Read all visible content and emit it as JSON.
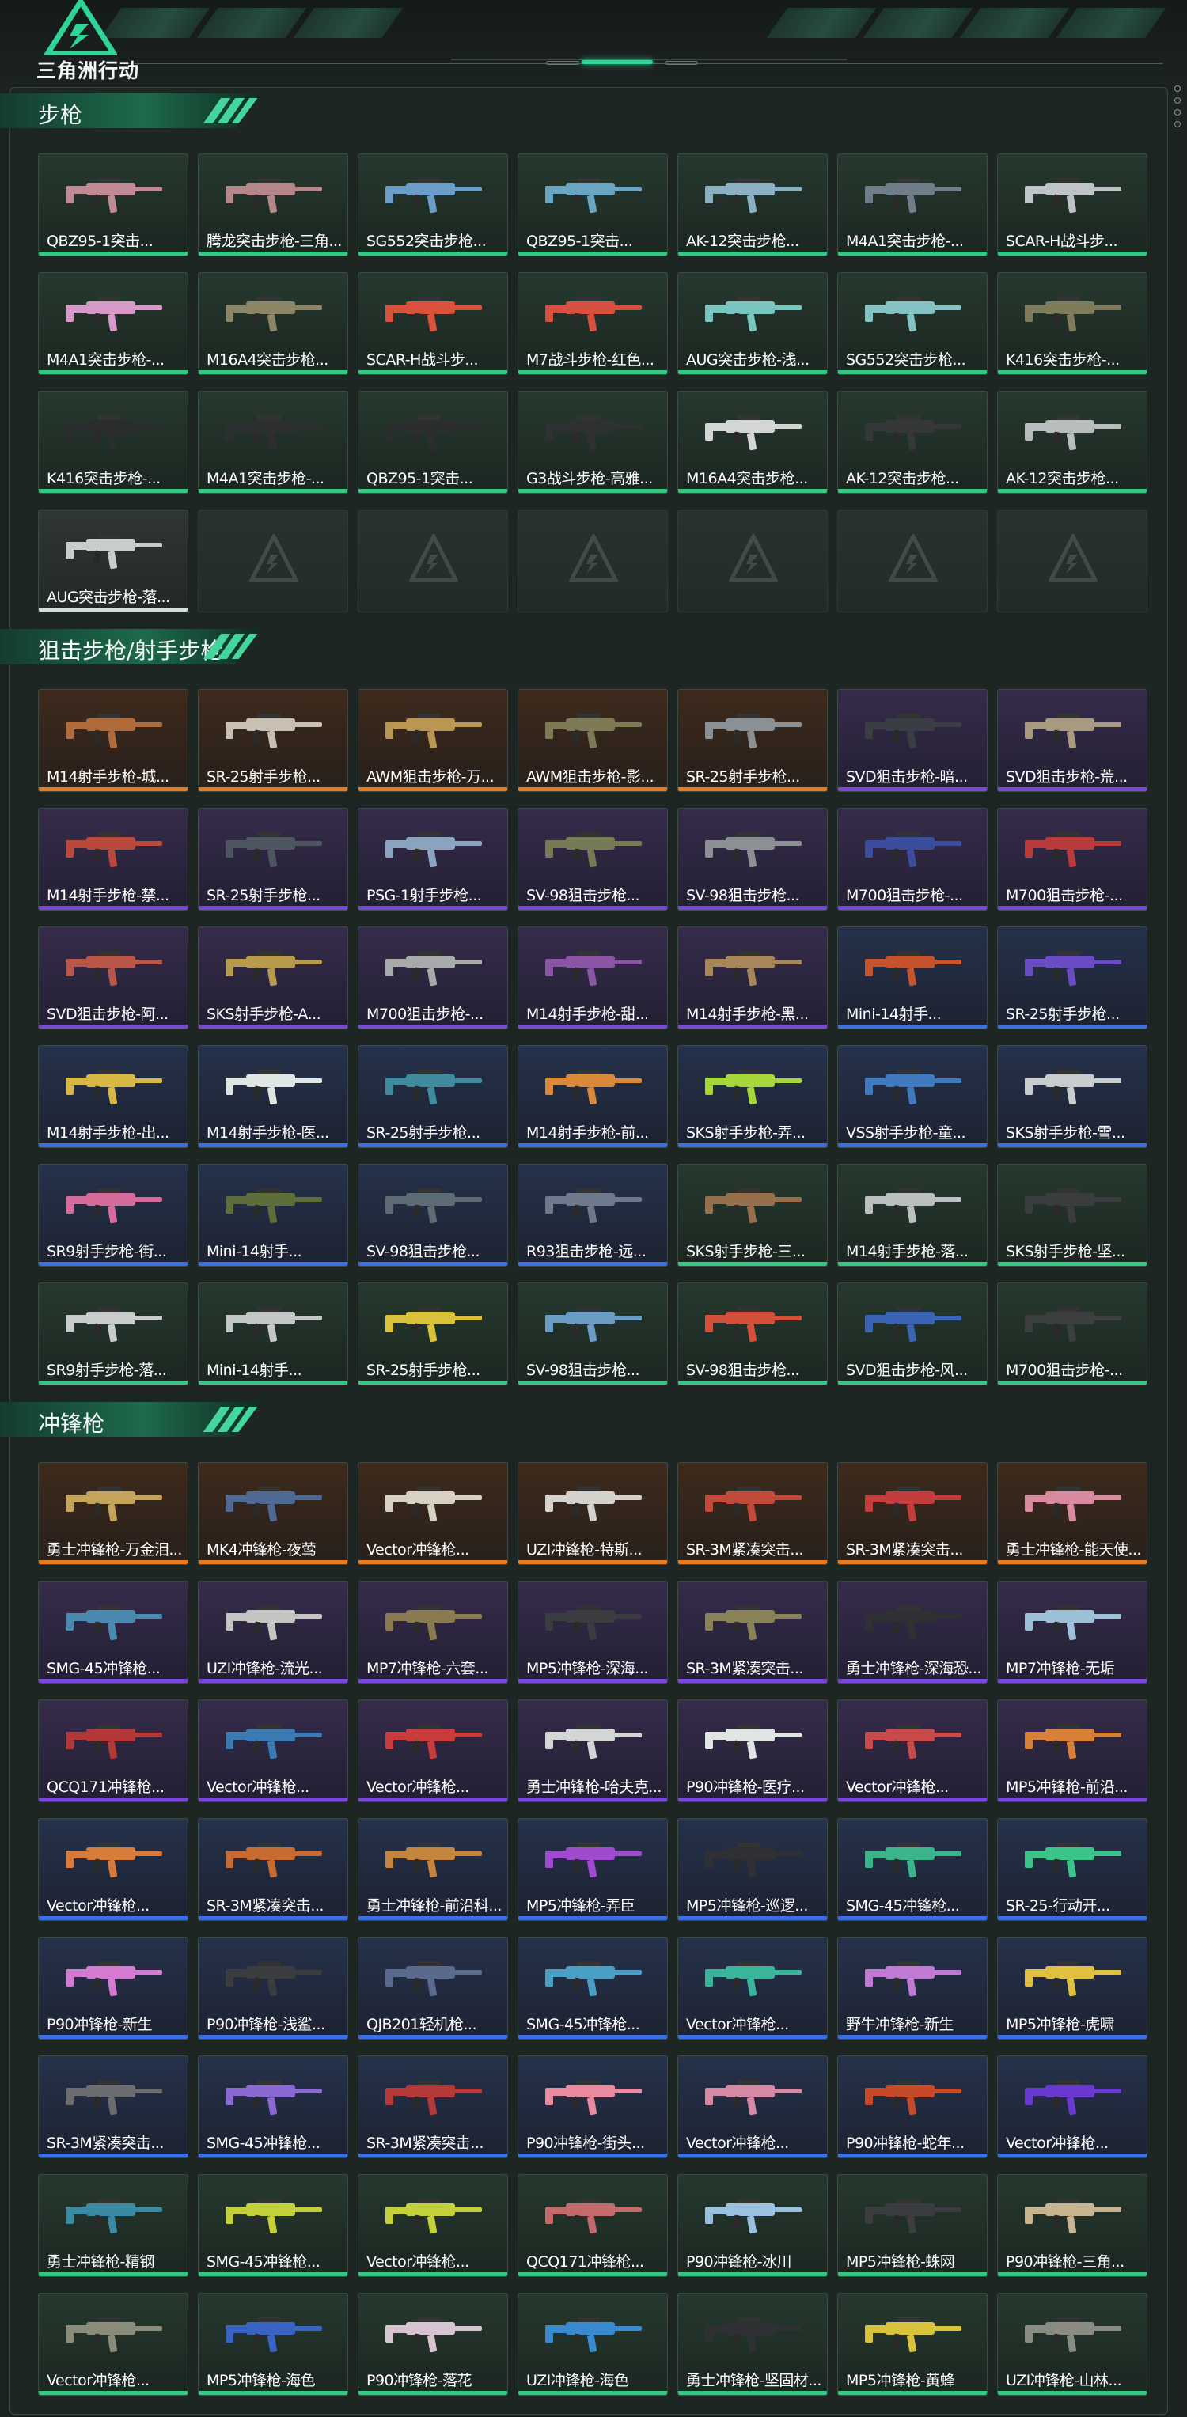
{
  "header": {
    "logo_text": "三角洲行动"
  },
  "sections": [
    {
      "title": "步枪",
      "rarity_colors": {
        "white": "#d6dcda",
        "green": "#37c783",
        "blue": "#3c6fe0",
        "purple": "#7a48d6",
        "orange": "#e57b23"
      },
      "items": [
        {
          "label": "QBZ95-1突击...",
          "rarity": "green",
          "tint": "#c08a94"
        },
        {
          "label": "腾龙突击步枪-三角...",
          "rarity": "green",
          "tint": "#b4878b"
        },
        {
          "label": "SG552突击步枪...",
          "rarity": "green",
          "tint": "#6a9ec8"
        },
        {
          "label": "QBZ95-1突击...",
          "rarity": "green",
          "tint": "#6aa5c2"
        },
        {
          "label": "AK-12突击步枪...",
          "rarity": "green",
          "tint": "#8bb0c4"
        },
        {
          "label": "M4A1突击步枪-...",
          "rarity": "green",
          "tint": "#6f7e88"
        },
        {
          "label": "SCAR-H战斗步...",
          "rarity": "green",
          "tint": "#bfc4c6"
        },
        {
          "label": "M4A1突击步枪-...",
          "rarity": "green",
          "tint": "#d79ac8"
        },
        {
          "label": "M16A4突击步枪...",
          "rarity": "green",
          "tint": "#8c8666"
        },
        {
          "label": "SCAR-H战斗步...",
          "rarity": "green",
          "tint": "#d9523b"
        },
        {
          "label": "M7战斗步枪-红色...",
          "rarity": "green",
          "tint": "#d8503f"
        },
        {
          "label": "AUG突击步枪-浅...",
          "rarity": "green",
          "tint": "#79c5c0"
        },
        {
          "label": "SG552突击步枪...",
          "rarity": "green",
          "tint": "#84c2c4"
        },
        {
          "label": "K416突击步枪-...",
          "rarity": "green",
          "tint": "#7f7c5c"
        },
        {
          "label": "K416突击步枪-...",
          "rarity": "green",
          "tint": "#2a2c2d"
        },
        {
          "label": "M4A1突击步枪-...",
          "rarity": "green",
          "tint": "#2c2e30"
        },
        {
          "label": "QBZ95-1突击...",
          "rarity": "green",
          "tint": "#2b2d2e"
        },
        {
          "label": "G3战斗步枪-高雅...",
          "rarity": "green",
          "tint": "#2e3032"
        },
        {
          "label": "M16A4突击步枪...",
          "rarity": "green",
          "tint": "#d4d6d6"
        },
        {
          "label": "AK-12突击步枪...",
          "rarity": "green",
          "tint": "#353739"
        },
        {
          "label": "AK-12突击步枪...",
          "rarity": "green",
          "tint": "#b8bcbc"
        },
        {
          "label": "AUG突击步枪-落...",
          "rarity": "white",
          "tint": "#c9cccc"
        },
        {
          "empty": true
        },
        {
          "empty": true
        },
        {
          "empty": true
        },
        {
          "empty": true
        },
        {
          "empty": true
        },
        {
          "empty": true
        }
      ]
    },
    {
      "title": "狙击步枪/射手步枪",
      "items": [
        {
          "label": "M14射手步枪-城...",
          "rarity": "orange",
          "tint": "#b06b3a"
        },
        {
          "label": "SR-25射手步枪...",
          "rarity": "orange",
          "tint": "#c9c0b4"
        },
        {
          "label": "AWM狙击步枪-万...",
          "rarity": "orange",
          "tint": "#b99652"
        },
        {
          "label": "AWM狙击步枪-影...",
          "rarity": "orange",
          "tint": "#7d7a55"
        },
        {
          "label": "SR-25射手步枪...",
          "rarity": "orange",
          "tint": "#8a9094"
        },
        {
          "label": "SVD狙击步枪-暗...",
          "rarity": "purple",
          "tint": "#3b3d44"
        },
        {
          "label": "SVD狙击步枪-荒...",
          "rarity": "purple",
          "tint": "#a89a80"
        },
        {
          "label": "M14射手步枪-禁...",
          "rarity": "purple",
          "tint": "#b9493a"
        },
        {
          "label": "SR-25射手步枪...",
          "rarity": "purple",
          "tint": "#4d5560"
        },
        {
          "label": "PSG-1射手步枪...",
          "rarity": "purple",
          "tint": "#8aa4c0"
        },
        {
          "label": "SV-98狙击步枪...",
          "rarity": "purple",
          "tint": "#767a55"
        },
        {
          "label": "SV-98狙击步枪...",
          "rarity": "purple",
          "tint": "#8c8f94"
        },
        {
          "label": "M700狙击步枪-...",
          "rarity": "purple",
          "tint": "#3a4c9c"
        },
        {
          "label": "M700狙击步枪-...",
          "rarity": "purple",
          "tint": "#b83a3a"
        },
        {
          "label": "SVD狙击步枪-阿...",
          "rarity": "purple",
          "tint": "#b9564a"
        },
        {
          "label": "SKS射手步枪-A...",
          "rarity": "purple",
          "tint": "#b79a4c"
        },
        {
          "label": "M700狙击步枪-...",
          "rarity": "purple",
          "tint": "#a8a9ab"
        },
        {
          "label": "M14射手步枪-甜...",
          "rarity": "purple",
          "tint": "#8a55a4"
        },
        {
          "label": "M14射手步枪-黑...",
          "rarity": "purple",
          "tint": "#a8865c"
        },
        {
          "label": "Mini-14射手...",
          "rarity": "blue",
          "tint": "#c4532e"
        },
        {
          "label": "SR-25射手步枪...",
          "rarity": "blue",
          "tint": "#6a4cc4"
        },
        {
          "label": "M14射手步枪-出...",
          "rarity": "blue",
          "tint": "#d8b844"
        },
        {
          "label": "M14射手步枪-医...",
          "rarity": "blue",
          "tint": "#dfe6e4"
        },
        {
          "label": "SR-25射手步枪...",
          "rarity": "blue",
          "tint": "#3f8a9c"
        },
        {
          "label": "M14射手步枪-前...",
          "rarity": "blue",
          "tint": "#d88a3a"
        },
        {
          "label": "SKS射手步枪-弄...",
          "rarity": "blue",
          "tint": "#a7d63a"
        },
        {
          "label": "VSS射手步枪-童...",
          "rarity": "blue",
          "tint": "#3f7ac0"
        },
        {
          "label": "SKS射手步枪-雪...",
          "rarity": "blue",
          "tint": "#c9cccc"
        },
        {
          "label": "SR9射手步枪-街...",
          "rarity": "blue",
          "tint": "#d46b9a"
        },
        {
          "label": "Mini-14射手...",
          "rarity": "blue",
          "tint": "#5e6e3a"
        },
        {
          "label": "SV-98狙击步枪...",
          "rarity": "blue",
          "tint": "#5d6c74"
        },
        {
          "label": "R93狙击步枪-远...",
          "rarity": "blue",
          "tint": "#6e7a8c"
        },
        {
          "label": "SKS射手步枪-三...",
          "rarity": "green",
          "tint": "#96704c"
        },
        {
          "label": "M14射手步枪-落...",
          "rarity": "green",
          "tint": "#bcbfc0"
        },
        {
          "label": "SKS射手步枪-坚...",
          "rarity": "green",
          "tint": "#3a3c3e"
        },
        {
          "label": "SR9射手步枪-落...",
          "rarity": "green",
          "tint": "#c9cccc"
        },
        {
          "label": "Mini-14射手...",
          "rarity": "green",
          "tint": "#c4c7c8"
        },
        {
          "label": "SR-25射手步枪...",
          "rarity": "green",
          "tint": "#d9c23a"
        },
        {
          "label": "SV-98狙击步枪...",
          "rarity": "green",
          "tint": "#6a9cc4"
        },
        {
          "label": "SV-98狙击步枪...",
          "rarity": "green",
          "tint": "#d4503a"
        },
        {
          "label": "SVD狙击步枪-风...",
          "rarity": "green",
          "tint": "#3a64b4"
        },
        {
          "label": "M700狙击步枪-...",
          "rarity": "green",
          "tint": "#3c3e40"
        }
      ]
    },
    {
      "title": "冲锋枪",
      "items": [
        {
          "label": "勇士冲锋枪-万金泪...",
          "rarity": "orange",
          "tint": "#c4a45a"
        },
        {
          "label": "MK4冲锋枪-夜莺",
          "rarity": "orange",
          "tint": "#4e6a94"
        },
        {
          "label": "Vector冲锋枪...",
          "rarity": "orange",
          "tint": "#d8d0c0"
        },
        {
          "label": "UZI冲锋枪-特斯...",
          "rarity": "orange",
          "tint": "#d4d2cc"
        },
        {
          "label": "SR-3M紧凑突击...",
          "rarity": "orange",
          "tint": "#c24a3a"
        },
        {
          "label": "SR-3M紧凑突击...",
          "rarity": "orange",
          "tint": "#c43c3c"
        },
        {
          "label": "勇士冲锋枪-能天使...",
          "rarity": "orange",
          "tint": "#d88aa0"
        },
        {
          "label": "SMG-45冲锋枪...",
          "rarity": "purple",
          "tint": "#4a8ab0"
        },
        {
          "label": "UZI冲锋枪-流光...",
          "rarity": "purple",
          "tint": "#c4c4c2"
        },
        {
          "label": "MP7冲锋枪-六套...",
          "rarity": "purple",
          "tint": "#8a7a50"
        },
        {
          "label": "MP5冲锋枪-深海...",
          "rarity": "purple",
          "tint": "#3a3c40"
        },
        {
          "label": "SR-3M紧凑突击...",
          "rarity": "purple",
          "tint": "#8a8258"
        },
        {
          "label": "勇士冲锋枪-深海恐...",
          "rarity": "purple",
          "tint": "#2e3034"
        },
        {
          "label": "MP7冲锋枪-无垢",
          "rarity": "purple",
          "tint": "#9cc0d8"
        },
        {
          "label": "QCQ171冲锋枪...",
          "rarity": "purple",
          "tint": "#b43838"
        },
        {
          "label": "Vector冲锋枪...",
          "rarity": "purple",
          "tint": "#3c7ab4"
        },
        {
          "label": "Vector冲锋枪...",
          "rarity": "purple",
          "tint": "#c83c3c"
        },
        {
          "label": "勇士冲锋枪-哈夫克...",
          "rarity": "purple",
          "tint": "#d4d6d6"
        },
        {
          "label": "P90冲锋枪-医疗...",
          "rarity": "purple",
          "tint": "#e0e4e2"
        },
        {
          "label": "Vector冲锋枪...",
          "rarity": "purple",
          "tint": "#c84a4a"
        },
        {
          "label": "MP5冲锋枪-前沿...",
          "rarity": "purple",
          "tint": "#d8803a"
        },
        {
          "label": "Vector冲锋枪...",
          "rarity": "blue",
          "tint": "#d87a3a"
        },
        {
          "label": "SR-3M紧凑突击...",
          "rarity": "blue",
          "tint": "#c86a32"
        },
        {
          "label": "勇士冲锋枪-前沿科...",
          "rarity": "blue",
          "tint": "#c4843c"
        },
        {
          "label": "MP5冲锋枪-弄臣",
          "rarity": "blue",
          "tint": "#a04ad0"
        },
        {
          "label": "MP5冲锋枪-巡逻...",
          "rarity": "blue",
          "tint": "#2e3034"
        },
        {
          "label": "SMG-45冲锋枪...",
          "rarity": "blue",
          "tint": "#3ab48a"
        },
        {
          "label": "SR-25-行动开...",
          "rarity": "blue",
          "tint": "#3ac48a"
        },
        {
          "label": "P90冲锋枪-新生",
          "rarity": "blue",
          "tint": "#d47ad0"
        },
        {
          "label": "P90冲锋枪-浅鲨...",
          "rarity": "blue",
          "tint": "#3a3c40"
        },
        {
          "label": "QJB201轻机枪...",
          "rarity": "blue",
          "tint": "#5a6a8c"
        },
        {
          "label": "SMG-45冲锋枪...",
          "rarity": "blue",
          "tint": "#4aa0c4"
        },
        {
          "label": "Vector冲锋枪...",
          "rarity": "blue",
          "tint": "#3ab49a"
        },
        {
          "label": "野牛冲锋枪-新生",
          "rarity": "blue",
          "tint": "#c07ad4"
        },
        {
          "label": "MP5冲锋枪-虎啸",
          "rarity": "blue",
          "tint": "#e0c040"
        },
        {
          "label": "SR-3M紧凑突击...",
          "rarity": "blue",
          "tint": "#6a6c70"
        },
        {
          "label": "SMG-45冲锋枪...",
          "rarity": "blue",
          "tint": "#8a6ad0"
        },
        {
          "label": "SR-3M紧凑突击...",
          "rarity": "blue",
          "tint": "#b43a3a"
        },
        {
          "label": "P90冲锋枪-街头...",
          "rarity": "blue",
          "tint": "#e88aa0"
        },
        {
          "label": "Vector冲锋枪...",
          "rarity": "blue",
          "tint": "#d48aa4"
        },
        {
          "label": "P90冲锋枪-蛇年...",
          "rarity": "blue",
          "tint": "#c44a2a"
        },
        {
          "label": "Vector冲锋枪...",
          "rarity": "blue",
          "tint": "#6a3ad0"
        },
        {
          "label": "勇士冲锋枪-精钢",
          "rarity": "green",
          "tint": "#3a8aa4"
        },
        {
          "label": "SMG-45冲锋枪...",
          "rarity": "green",
          "tint": "#c4d03a"
        },
        {
          "label": "Vector冲锋枪...",
          "rarity": "green",
          "tint": "#c4d03a"
        },
        {
          "label": "QCQ171冲锋枪...",
          "rarity": "green",
          "tint": "#c46a6a"
        },
        {
          "label": "P90冲锋枪-冰川",
          "rarity": "green",
          "tint": "#9cc0e0"
        },
        {
          "label": "MP5冲锋枪-蛛网",
          "rarity": "green",
          "tint": "#3a3c40"
        },
        {
          "label": "P90冲锋枪-三角...",
          "rarity": "green",
          "tint": "#c8b490"
        },
        {
          "label": "Vector冲锋枪...",
          "rarity": "green",
          "tint": "#8a8c7a"
        },
        {
          "label": "MP5冲锋枪-海色",
          "rarity": "green",
          "tint": "#3a64c4"
        },
        {
          "label": "P90冲锋枪-落花",
          "rarity": "green",
          "tint": "#d8c4d0"
        },
        {
          "label": "UZI冲锋枪-海色",
          "rarity": "green",
          "tint": "#3a8ad0"
        },
        {
          "label": "勇士冲锋枪-坚固材...",
          "rarity": "green",
          "tint": "#2e3034"
        },
        {
          "label": "MP5冲锋枪-黄蜂",
          "rarity": "green",
          "tint": "#d8c43a"
        },
        {
          "label": "UZI冲锋枪-山林...",
          "rarity": "green",
          "tint": "#8a8c84"
        }
      ]
    }
  ]
}
